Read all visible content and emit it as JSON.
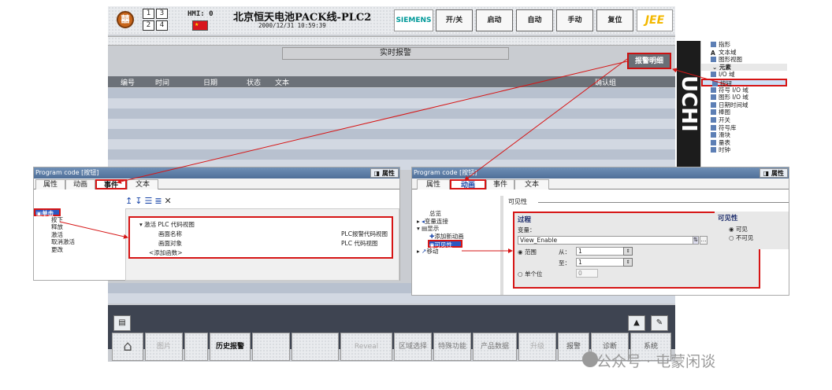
{
  "header": {
    "hmi_label": "HMI: 0",
    "num_buttons": [
      "1",
      "3",
      "2",
      "4"
    ],
    "title": "北京恒天电池PACK线-PLC2",
    "datetime": "2000/12/31 10:59:39",
    "brand": "SIEMENS",
    "buttons": [
      "开/关",
      "启动",
      "自动",
      "手动",
      "复位"
    ],
    "logo2": "JEE"
  },
  "alarm_view": {
    "banner": "实时报警",
    "detail_button": "报警明细",
    "columns": [
      "编号",
      "时间",
      "日期",
      "状态",
      "文本",
      "确认组"
    ]
  },
  "ruler_text": "UCHI",
  "toolbox": {
    "items_top": [
      "指形",
      "文本域",
      "图形视图"
    ],
    "section": "元素",
    "items": [
      "I/O 域",
      "按钮",
      "符号 I/O 域",
      "图形 I/O 域",
      "日期时间域",
      "棒图",
      "开关",
      "符号库",
      "滑块",
      "量表",
      "时钟"
    ]
  },
  "panel_events": {
    "title_prefix": "Program code ",
    "title_sel": "[按钮]",
    "prop_tab": "属性",
    "tabs": [
      "属性",
      "动画",
      "事件",
      "文本"
    ],
    "events": [
      "单击",
      "按下",
      "释放",
      "激活",
      "取消激活",
      "更改"
    ],
    "func_name": "激活 PLC 代码视图",
    "params": [
      {
        "name": "画面名称",
        "value": "PLC报警代码视图"
      },
      {
        "name": "画面对象",
        "value": "PLC 代码视图"
      }
    ],
    "add_func": "<添加函数>"
  },
  "panel_anim": {
    "title_prefix": "Program code ",
    "title_sel": "[按钮]",
    "prop_tab": "属性",
    "tabs": [
      "属性",
      "动画",
      "事件",
      "文本"
    ],
    "tree": [
      "总览",
      "变量连接",
      "显示",
      "添加新动画",
      "可见性",
      "移动"
    ],
    "visibility_header": "可见性",
    "process_label": "过程",
    "variable_label": "变量：",
    "variable_value": "View_Enable",
    "range_label": "范围",
    "from_label": "从：",
    "from_value": "1",
    "to_label": "至：",
    "to_value": "1",
    "single_bit_label": "单个位",
    "single_bit_value": "0",
    "vis_options_title": "可见性",
    "vis_visible": "可见",
    "vis_invisible": "不可见"
  },
  "nav": [
    "图片",
    "",
    "历史报警",
    "",
    "",
    "Reveal",
    "区域选择",
    "特殊功能",
    "产品数据",
    "升级",
    "报警",
    "诊断",
    "系统"
  ],
  "watermark": "公众号 · 屯蒙闲谈"
}
